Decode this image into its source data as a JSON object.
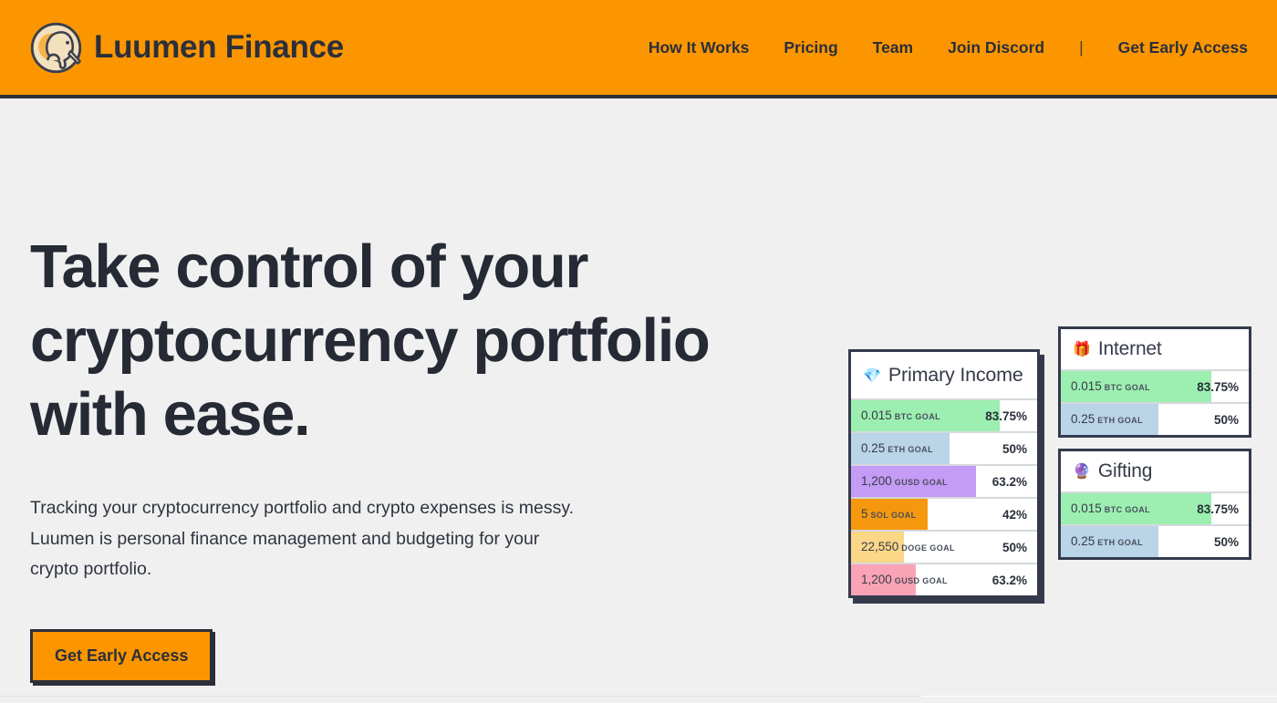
{
  "brand": {
    "name": "Luumen Finance",
    "logo_icon": "kiwi-bird-logo",
    "logo_bg_color": "#f3e0bd",
    "logo_accent_color": "#f6b24a",
    "logo_outline_color": "#3a3f4d"
  },
  "header": {
    "background_color": "#fb9601",
    "border_color": "#2b2f3a",
    "nav": [
      {
        "label": "How It Works"
      },
      {
        "label": "Pricing"
      },
      {
        "label": "Team"
      },
      {
        "label": "Join Discord"
      }
    ],
    "separator": "|",
    "cta_label": "Get Early Access"
  },
  "hero": {
    "headline": "Take control of your cryptocurrency portfolio with ease.",
    "subcopy": "Tracking your cryptocurrency portfolio and crypto expenses is messy. Luumen is personal finance management and budgeting for your crypto portfolio.",
    "cta_label": "Get Early Access",
    "cta_bg_color": "#fb9601",
    "text_color": "#262a35"
  },
  "page": {
    "background_color": "#f0f0f0"
  },
  "cards": [
    {
      "id": "primary-income",
      "emoji": "💎",
      "emoji_name": "gem-stone-icon",
      "title": "Primary Income",
      "rows": [
        {
          "amount": "0.015",
          "unit": "BTC GOAL",
          "percent": "83.75%",
          "fill_pct": 80,
          "color": "#9cefb0"
        },
        {
          "amount": "0.25",
          "unit": "ETH GOAL",
          "percent": "50%",
          "fill_pct": 53,
          "color": "#bad4e8"
        },
        {
          "amount": "1,200",
          "unit": "GUSD GOAL",
          "percent": "63.2%",
          "fill_pct": 67,
          "color": "#c49bf5"
        },
        {
          "amount": "5",
          "unit": "SOL GOAL",
          "percent": "42%",
          "fill_pct": 41,
          "color": "#f6980d"
        },
        {
          "amount": "22,550",
          "unit": "DOGE GOAL",
          "percent": "50%",
          "fill_pct": 28.5,
          "color": "#fcd788"
        },
        {
          "amount": "1,200",
          "unit": "GUSD GOAL",
          "percent": "63.2%",
          "fill_pct": 35,
          "color": "#fba3b6"
        }
      ]
    },
    {
      "id": "internet",
      "emoji": "🎁",
      "emoji_name": "wrapped-gift-icon",
      "title": "Internet",
      "rows": [
        {
          "amount": "0.015",
          "unit": "BTC GOAL",
          "percent": "83.75%",
          "fill_pct": 80,
          "color": "#9cefb0"
        },
        {
          "amount": "0.25",
          "unit": "ETH GOAL",
          "percent": "50%",
          "fill_pct": 52,
          "color": "#bad4e8"
        }
      ]
    },
    {
      "id": "gifting",
      "emoji": "🔮",
      "emoji_name": "crystal-ball-icon",
      "title": "Gifting",
      "rows": [
        {
          "amount": "0.015",
          "unit": "BTC GOAL",
          "percent": "83.75%",
          "fill_pct": 80,
          "color": "#9cefb0"
        },
        {
          "amount": "0.25",
          "unit": "ETH GOAL",
          "percent": "50%",
          "fill_pct": 52,
          "color": "#bad4e8"
        }
      ]
    }
  ]
}
